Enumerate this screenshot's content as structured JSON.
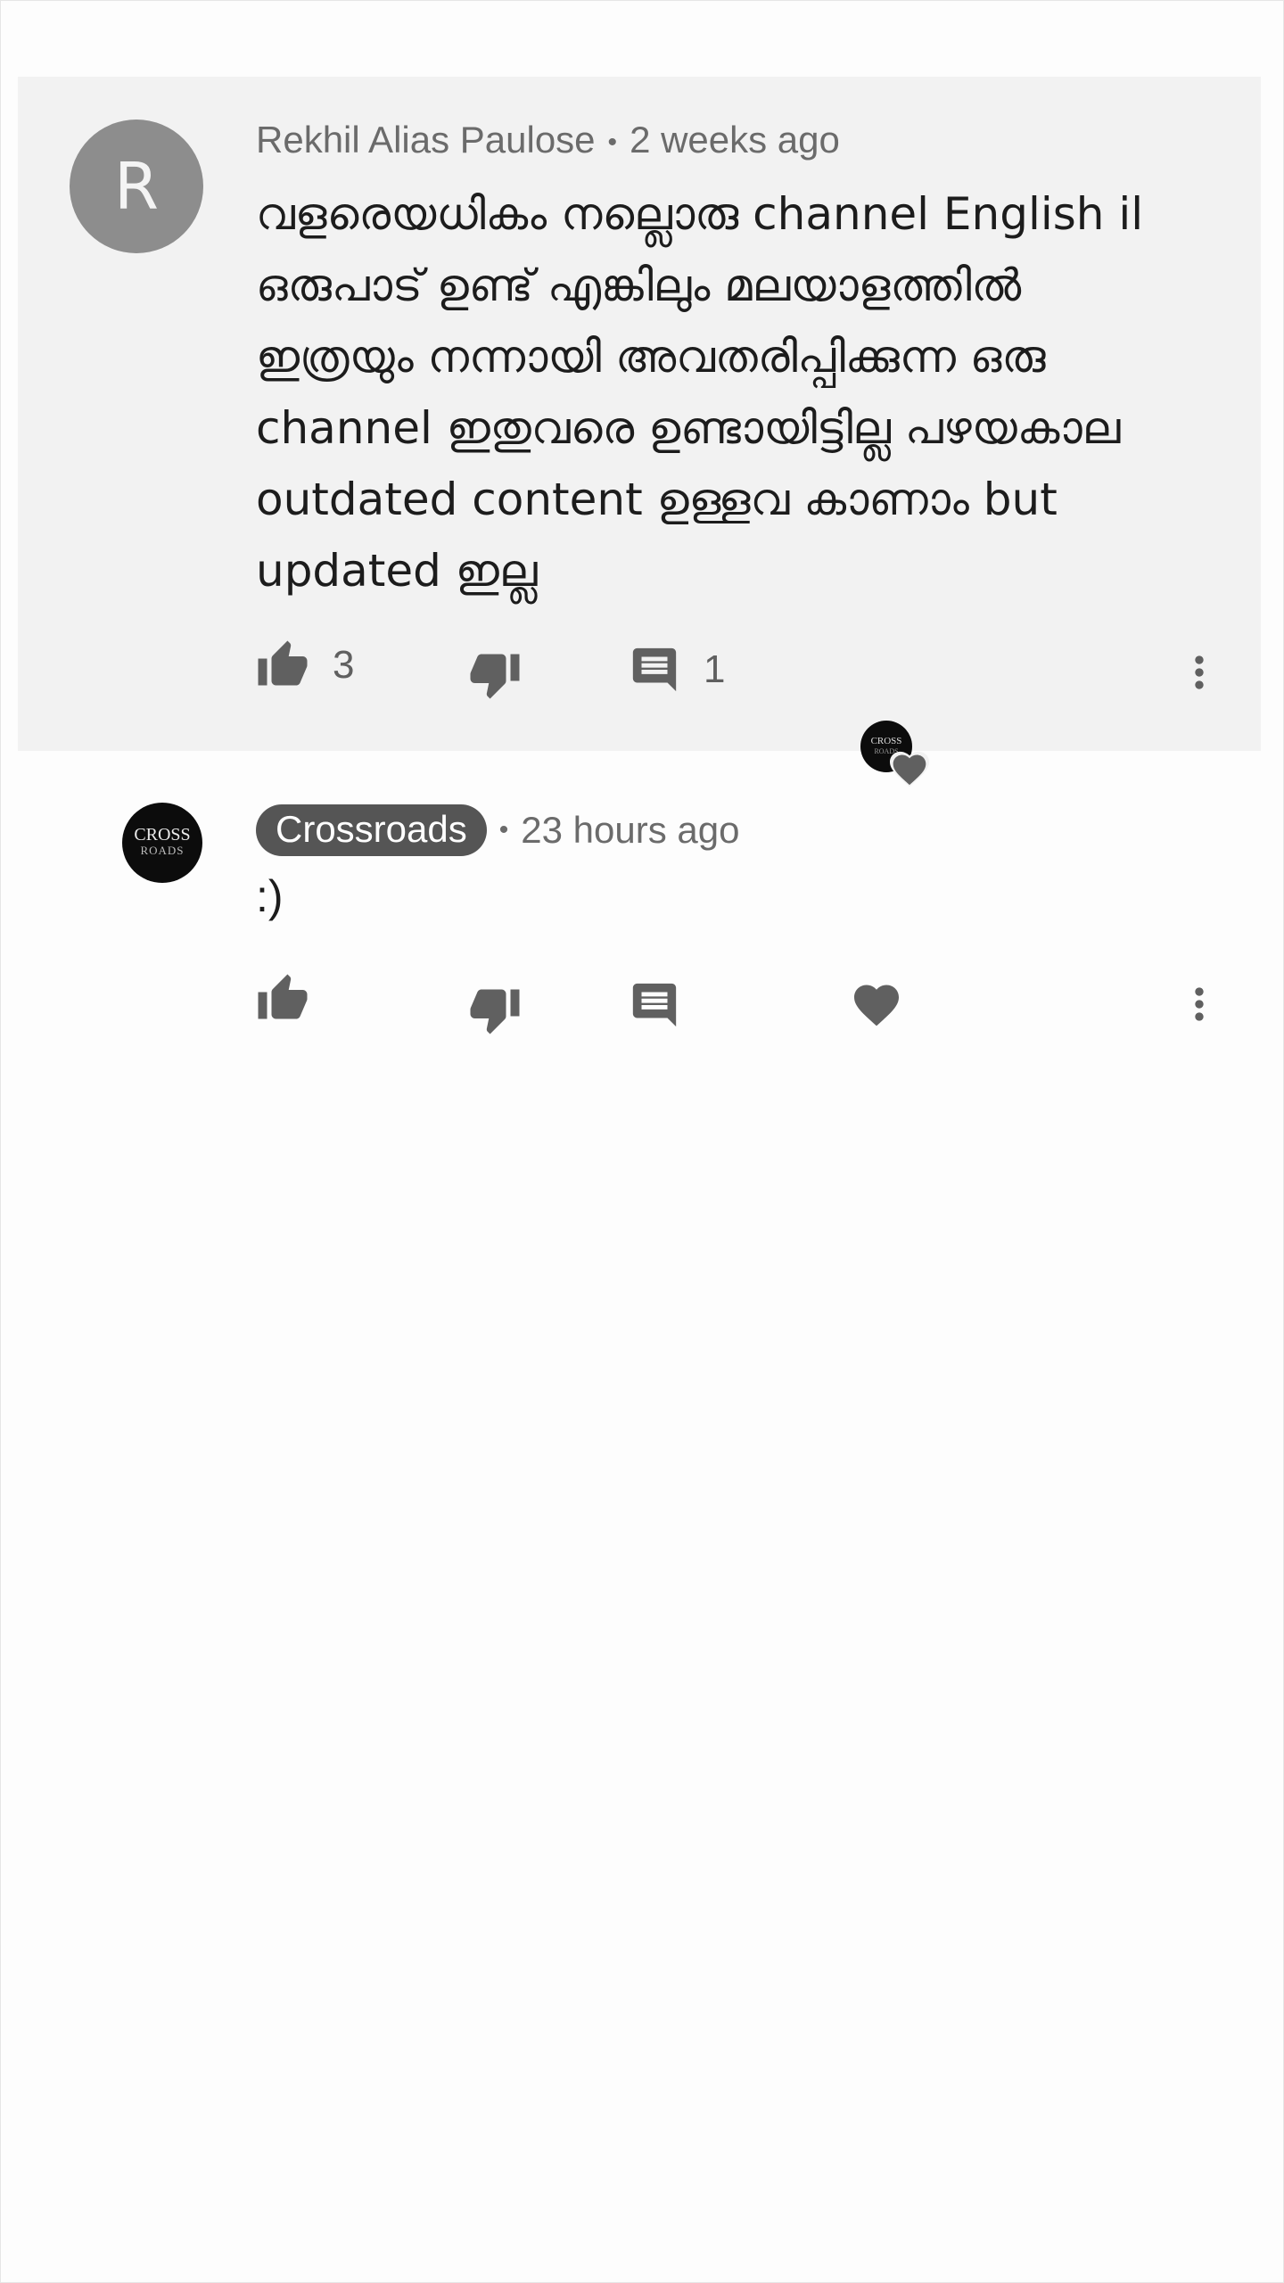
{
  "comment": {
    "author_initial": "R",
    "author": "Rekhil Alias Paulose",
    "separator": "•",
    "time": "2 weeks ago",
    "text": "വളരെയധികം നല്ലൊരു channel English il ഒരുപാട് ഉണ്ട് എങ്കിലും മലയാളത്തിൽ ഇത്രയും നന്നായി അവതരിപ്പിക്കുന്ന ഒരു channel ഇതുവരെ ഉണ്ടായിട്ടില്ല പഴയകാല outdated content ഉള്ളവ കാണാം but updated ഇല്ല",
    "like_count": "3",
    "reply_count": "1",
    "creator_heart_avatar": {
      "line1": "CROSS",
      "line2": "ROADS"
    }
  },
  "reply": {
    "avatar": {
      "line1": "CROSS",
      "line2": "ROADS"
    },
    "author": "Crossroads",
    "separator": "•",
    "time": "23 hours ago",
    "text": ":)"
  },
  "colors": {
    "card_background": "#f2f2f2",
    "page_background": "#fdfdfd",
    "icon": "#606060",
    "author_badge": "#555555"
  },
  "icons": [
    "thumb-up-icon",
    "thumb-down-icon",
    "reply-icon",
    "heart-icon",
    "more-vert-icon"
  ]
}
